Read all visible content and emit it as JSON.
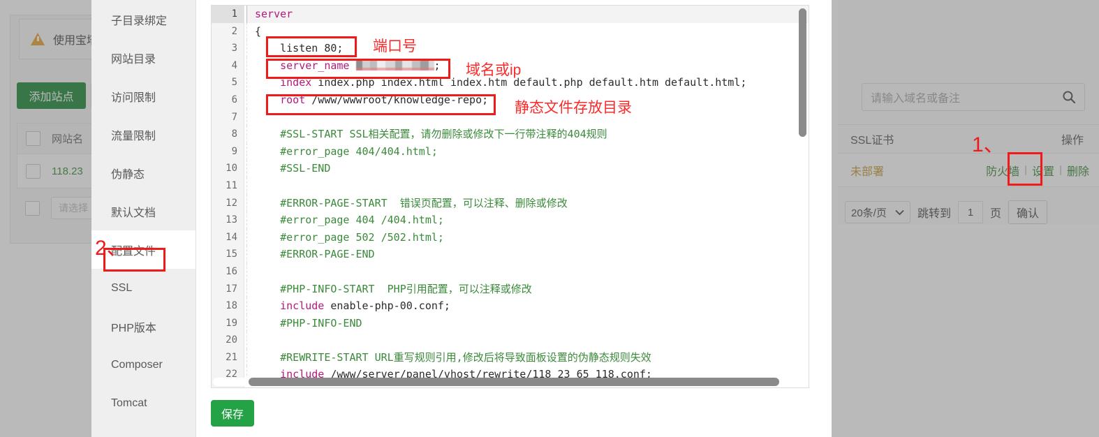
{
  "background": {
    "warning": {
      "text": "使用宝塔",
      "icon": "warning-triangle-icon"
    },
    "add_site_button": "添加站点",
    "table": {
      "header_col": "网站名",
      "row_value": "118.23",
      "filter_placeholder": "请选择"
    },
    "search": {
      "placeholder": "请输入域名或备注",
      "icon": "search-icon"
    },
    "columns": {
      "ssl": "SSL证书",
      "action": "操作"
    },
    "row": {
      "ssl_status": "未部署",
      "actions": [
        "防火墙",
        "设置",
        "删除"
      ],
      "divider": "|"
    },
    "pager": {
      "page_size": "20条/页",
      "jump_label": "跳转到",
      "page_value": "1",
      "page_unit": "页",
      "confirm": "确认",
      "chevron": "chevron-down-icon"
    }
  },
  "modal": {
    "sidebar": [
      {
        "label": "子目录绑定",
        "active": false
      },
      {
        "label": "网站目录",
        "active": false
      },
      {
        "label": "访问限制",
        "active": false
      },
      {
        "label": "流量限制",
        "active": false
      },
      {
        "label": "伪静态",
        "active": false
      },
      {
        "label": "默认文档",
        "active": false
      },
      {
        "label": "配置文件",
        "active": true
      },
      {
        "label": "SSL",
        "active": false
      },
      {
        "label": "PHP版本",
        "active": false
      },
      {
        "label": "Composer",
        "active": false
      },
      {
        "label": "Tomcat",
        "active": false
      }
    ],
    "save_button": "保存"
  },
  "editor": {
    "lines": [
      {
        "no": "1",
        "current": true,
        "segments": [
          {
            "t": "server",
            "c": "kw"
          }
        ]
      },
      {
        "no": "2",
        "current": false,
        "segments": [
          {
            "t": "{",
            "c": ""
          }
        ]
      },
      {
        "no": "3",
        "current": false,
        "segments": [
          {
            "t": "    listen 80;",
            "c": ""
          }
        ]
      },
      {
        "no": "4",
        "current": false,
        "segments": [
          {
            "t": "    server_name ",
            "c": "kw"
          },
          {
            "t": "",
            "c": "blur"
          },
          {
            "t": ";",
            "c": ""
          }
        ]
      },
      {
        "no": "5",
        "current": false,
        "segments": [
          {
            "t": "    index",
            "c": "kw"
          },
          {
            "t": " index.php index.html index.htm default.php default.htm default.html;",
            "c": ""
          }
        ]
      },
      {
        "no": "6",
        "current": false,
        "segments": [
          {
            "t": "    root",
            "c": "kw"
          },
          {
            "t": " /www/wwwroot/knowledge-repo;",
            "c": ""
          }
        ]
      },
      {
        "no": "7",
        "current": false,
        "segments": [
          {
            "t": "",
            "c": ""
          }
        ]
      },
      {
        "no": "8",
        "current": false,
        "segments": [
          {
            "t": "    #SSL-START SSL相关配置，请勿删除或修改下一行带注释的404规则",
            "c": "cm"
          }
        ]
      },
      {
        "no": "9",
        "current": false,
        "segments": [
          {
            "t": "    #error_page 404/404.html;",
            "c": "cm"
          }
        ]
      },
      {
        "no": "10",
        "current": false,
        "segments": [
          {
            "t": "    #SSL-END",
            "c": "cm"
          }
        ]
      },
      {
        "no": "11",
        "current": false,
        "segments": [
          {
            "t": "",
            "c": ""
          }
        ]
      },
      {
        "no": "12",
        "current": false,
        "segments": [
          {
            "t": "    #ERROR-PAGE-START  错误页配置，可以注释、删除或修改",
            "c": "cm"
          }
        ]
      },
      {
        "no": "13",
        "current": false,
        "segments": [
          {
            "t": "    #error_page 404 /404.html;",
            "c": "cm"
          }
        ]
      },
      {
        "no": "14",
        "current": false,
        "segments": [
          {
            "t": "    #error_page 502 /502.html;",
            "c": "cm"
          }
        ]
      },
      {
        "no": "15",
        "current": false,
        "segments": [
          {
            "t": "    #ERROR-PAGE-END",
            "c": "cm"
          }
        ]
      },
      {
        "no": "16",
        "current": false,
        "segments": [
          {
            "t": "",
            "c": ""
          }
        ]
      },
      {
        "no": "17",
        "current": false,
        "segments": [
          {
            "t": "    #PHP-INFO-START  PHP引用配置，可以注释或修改",
            "c": "cm"
          }
        ]
      },
      {
        "no": "18",
        "current": false,
        "segments": [
          {
            "t": "    include",
            "c": "kw"
          },
          {
            "t": " enable-php-00.conf;",
            "c": ""
          }
        ]
      },
      {
        "no": "19",
        "current": false,
        "segments": [
          {
            "t": "    #PHP-INFO-END",
            "c": "cm"
          }
        ]
      },
      {
        "no": "20",
        "current": false,
        "segments": [
          {
            "t": "",
            "c": ""
          }
        ]
      },
      {
        "no": "21",
        "current": false,
        "segments": [
          {
            "t": "    #REWRITE-START URL重写规则引用,修改后将导致面板设置的伪静态规则失效",
            "c": "cm"
          }
        ]
      },
      {
        "no": "22",
        "current": false,
        "segments": [
          {
            "t": "    include",
            "c": "kw"
          },
          {
            "t": " /www/server/panel/vhost/rewrite/118_23_65_118.conf;",
            "c": ""
          }
        ]
      }
    ]
  },
  "annotations": {
    "port_label": "端口号",
    "domain_label": "域名或ip",
    "root_label": "静态文件存放目录",
    "step1": "1、",
    "step2": "2、",
    "box_color": "#ef1b1b",
    "text_color": "#fb2b2b"
  }
}
